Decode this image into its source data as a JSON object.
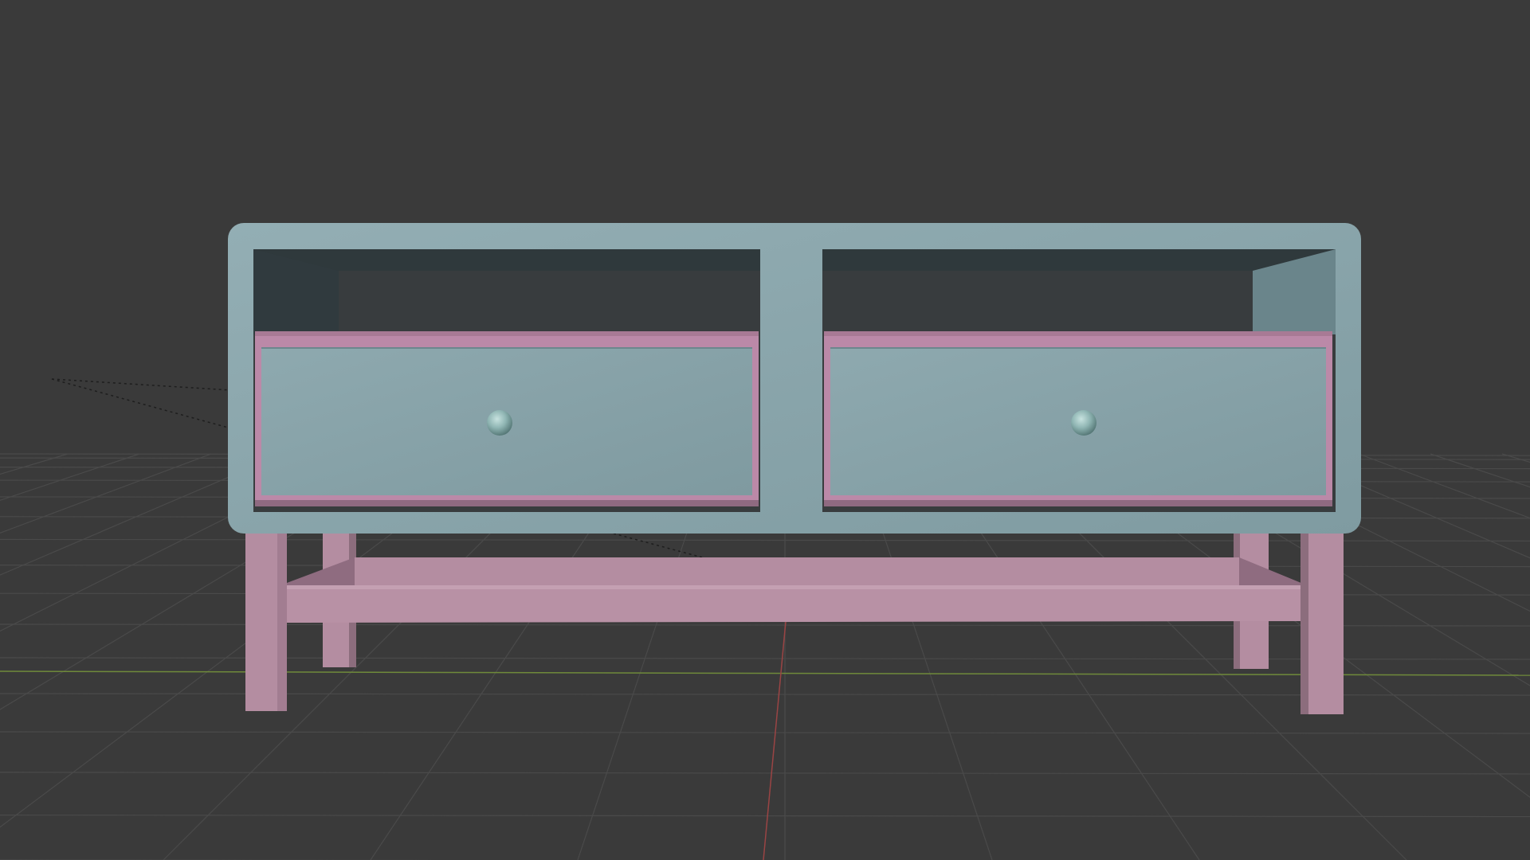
{
  "viewport": {
    "background_color": "#3a3a3a",
    "grid_line_color": "#4a4a4a",
    "x_axis_color": "#6f8a3a",
    "y_axis_color": "#9a4444",
    "camera_dash_color": "#1e1e1e"
  },
  "model": {
    "body_color": "#86a2a8",
    "body_highlight": "#97b1b7",
    "interior_back_color": "#373c3e",
    "interior_side_left": "#303a3e",
    "interior_side_right": "#6a858b",
    "interior_top": "#2f393c",
    "drawer_frame_color": "#bb89a8",
    "drawer_frame_dark": "#8f6a81",
    "drawer_front_color": "#86a2a8",
    "knob_color": "#8fb5b3",
    "stand_color": "#b48da1",
    "stand_dark": "#8c6d7d",
    "stand_light": "#c4a0b2"
  }
}
